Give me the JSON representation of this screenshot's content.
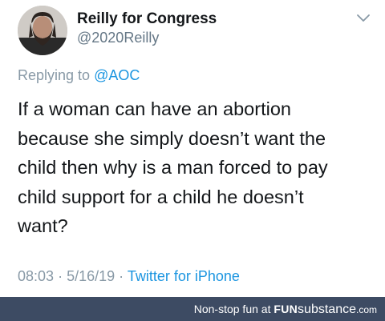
{
  "tweet": {
    "display_name": "Reilly for Congress",
    "handle": "@2020Reilly",
    "reply_prefix": "Replying to",
    "reply_mention": "@AOC",
    "text_lines": [
      "If a woman can have an abortion",
      "because she simply doesn’t want the",
      "child then why is a man forced to pay",
      "child support for a child he doesn’t",
      "want?"
    ],
    "time": "08:03",
    "separator": "·",
    "date": "5/16/19",
    "source": "Twitter for iPhone",
    "avatar_icon": "profile-photo-bearded-man",
    "menu_icon": "chevron-down-icon"
  },
  "watermark": {
    "prefix": "Non-stop fun at ",
    "brand_part1": "FUN",
    "brand_part2": "substance",
    "brand_part3": ".com",
    "bar_color": "#3d4b63"
  },
  "colors": {
    "text_primary": "#14171a",
    "text_secondary": "#8899a6",
    "link": "#1b95e0"
  }
}
